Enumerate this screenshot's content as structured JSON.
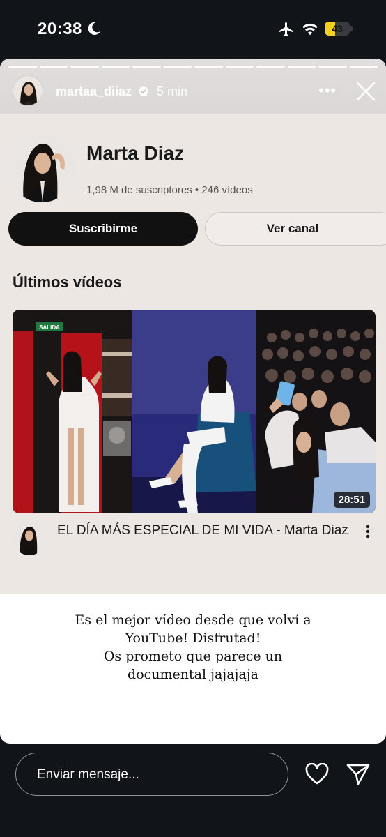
{
  "status_bar": {
    "time": "20:38",
    "battery_level": "43",
    "battery_fraction": 0.43,
    "icons": [
      "moon-icon",
      "airplane-icon",
      "wifi-icon",
      "battery-icon"
    ],
    "battery_color": "#f5d020"
  },
  "story": {
    "username": "martaa_diiaz",
    "verified": true,
    "posted": "5 min",
    "progress_segments": 12,
    "menu_icon": "more-horizontal-icon",
    "close_icon": "close-icon"
  },
  "shared_channel": {
    "channel_name": "Marta Diaz",
    "meta": "1,98 M de suscriptores • 246 vídeos",
    "subscribe_label": "Suscribirme",
    "view_channel_label": "Ver canal",
    "section_title": "Últimos vídeos",
    "video": {
      "title": "EL DÍA MÁS ESPECIAL DE MI VIDA - Marta Diaz",
      "duration": "28:51",
      "thumbnail_sign": "SALIDA"
    }
  },
  "caption_lines": [
    "Es el mejor vídeo desde que volví a",
    "YouTube! Disfrutad!",
    "Os prometo que parece un",
    "documental jajajaja"
  ],
  "bottom_bar": {
    "reply_placeholder": "Enviar mensaje...",
    "icons": [
      "heart-icon",
      "send-icon"
    ]
  },
  "colors": {
    "background": "#111418",
    "card_background": "#ede7e4",
    "button_dark": "#111111"
  }
}
